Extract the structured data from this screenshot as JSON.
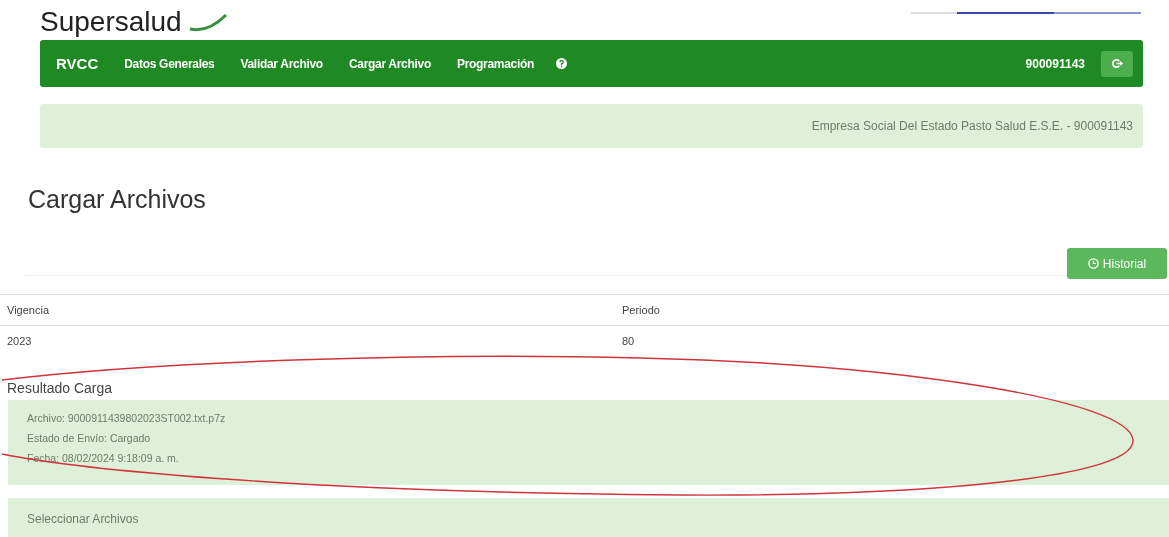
{
  "logo": {
    "text": "Supersalud"
  },
  "navbar": {
    "brand": "RVCC",
    "items": [
      {
        "label": "Datos Generales",
        "kind": "link"
      },
      {
        "label": "Validar Archivo",
        "kind": "link"
      },
      {
        "label": "Cargar Archivo",
        "kind": "link"
      },
      {
        "label": "Programación",
        "kind": "link"
      },
      {
        "kind": "help"
      }
    ],
    "user": "900091143"
  },
  "entity_bar": {
    "text": "Empresa Social Del Estado Pasto Salud E.S.E. - 900091143"
  },
  "page_title": "Cargar Archivos",
  "history_button": {
    "label": "Historial"
  },
  "table": {
    "columns": [
      "Vigencia",
      "Periodo"
    ],
    "rows": [
      [
        "2023",
        "80"
      ]
    ]
  },
  "result": {
    "title": "Resultado Carga",
    "lines": [
      "Archivo: 9000911439802023ST002.txt.p7z",
      "Estado de Envío: Cargado",
      "Fecha: 08/02/2024 9:18:09 a. m."
    ]
  },
  "select_panel": {
    "title": "Seleccionar Archivos"
  },
  "annotation": {
    "kind": "ellipse",
    "color": "#d0343a"
  }
}
